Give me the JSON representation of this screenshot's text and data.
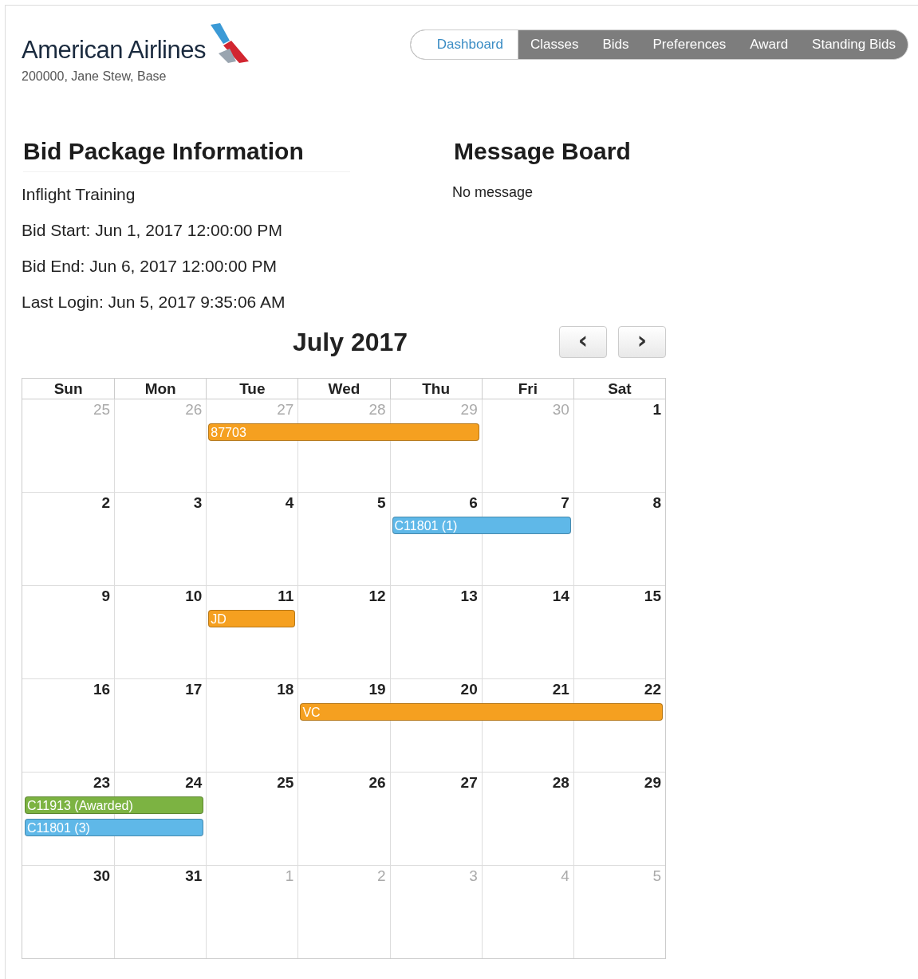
{
  "header": {
    "brand": "American Airlines",
    "user": "200000, Jane Stew, Base"
  },
  "nav": [
    {
      "label": "Dashboard",
      "selected": true
    },
    {
      "label": "Classes",
      "selected": false
    },
    {
      "label": "Bids",
      "selected": false
    },
    {
      "label": "Preferences",
      "selected": false
    },
    {
      "label": "Award",
      "selected": false
    },
    {
      "label": "Standing Bids",
      "selected": false
    }
  ],
  "bid_package": {
    "title": "Bid Package Information",
    "lines": [
      "Inflight Training",
      "Bid Start: Jun 1, 2017 12:00:00 PM",
      "Bid End: Jun 6, 2017 12:00:00 PM",
      "Last Login: Jun 5, 2017 9:35:06 AM"
    ]
  },
  "message_board": {
    "title": "Message Board",
    "text": "No message"
  },
  "calendar": {
    "title": "July 2017",
    "prev": "‹",
    "next": "›",
    "weekdays": [
      "Sun",
      "Mon",
      "Tue",
      "Wed",
      "Thu",
      "Fri",
      "Sat"
    ],
    "weeks": [
      [
        {
          "day": "25",
          "muted": true
        },
        {
          "day": "26",
          "muted": true
        },
        {
          "day": "27",
          "muted": true,
          "events": [
            {
              "label": "87703",
              "color": "#f5a020"
            }
          ]
        },
        {
          "day": "28",
          "muted": true,
          "events": [
            {
              "continued": true
            }
          ]
        },
        {
          "day": "29",
          "muted": true,
          "events": [
            {
              "continued": true
            }
          ]
        },
        {
          "day": "30",
          "muted": true
        },
        {
          "day": "1",
          "muted": false
        }
      ],
      [
        {
          "day": "2",
          "muted": false
        },
        {
          "day": "3",
          "muted": false
        },
        {
          "day": "4",
          "muted": false
        },
        {
          "day": "5",
          "muted": false
        },
        {
          "day": "6",
          "muted": false,
          "events": [
            {
              "label": "C11801 (1)",
              "color": "#5fb8e8"
            }
          ]
        },
        {
          "day": "7",
          "muted": false,
          "events": [
            {
              "continued": true
            }
          ]
        },
        {
          "day": "8",
          "muted": false
        }
      ],
      [
        {
          "day": "9",
          "muted": false
        },
        {
          "day": "10",
          "muted": false
        },
        {
          "day": "11",
          "muted": false,
          "events": [
            {
              "label": "JD",
              "color": "#f5a020"
            }
          ]
        },
        {
          "day": "12",
          "muted": false
        },
        {
          "day": "13",
          "muted": false
        },
        {
          "day": "14",
          "muted": false
        },
        {
          "day": "15",
          "muted": false
        }
      ],
      [
        {
          "day": "16",
          "muted": false
        },
        {
          "day": "17",
          "muted": false
        },
        {
          "day": "18",
          "muted": false
        },
        {
          "day": "19",
          "muted": false,
          "events": [
            {
              "label": "VC",
              "color": "#f5a020"
            }
          ]
        },
        {
          "day": "20",
          "muted": false,
          "events": [
            {
              "continued": true
            }
          ]
        },
        {
          "day": "21",
          "muted": false,
          "events": [
            {
              "continued": true
            }
          ]
        },
        {
          "day": "22",
          "muted": false,
          "events": [
            {
              "continued": true
            }
          ]
        }
      ],
      [
        {
          "day": "23",
          "muted": false,
          "events": [
            {
              "label": "C11913 (Awarded)",
              "color": "#7cb342"
            },
            {
              "label": "C11801 (3)",
              "color": "#5fb8e8"
            }
          ]
        },
        {
          "day": "24",
          "muted": false,
          "events": [
            {
              "continued": true
            },
            {
              "continued": true
            }
          ]
        },
        {
          "day": "25",
          "muted": false
        },
        {
          "day": "26",
          "muted": false
        },
        {
          "day": "27",
          "muted": false
        },
        {
          "day": "28",
          "muted": false
        },
        {
          "day": "29",
          "muted": false
        }
      ],
      [
        {
          "day": "30",
          "muted": false
        },
        {
          "day": "31",
          "muted": false
        },
        {
          "day": "1",
          "muted": true
        },
        {
          "day": "2",
          "muted": true
        },
        {
          "day": "3",
          "muted": true
        },
        {
          "day": "4",
          "muted": true
        },
        {
          "day": "5",
          "muted": true
        }
      ]
    ]
  }
}
